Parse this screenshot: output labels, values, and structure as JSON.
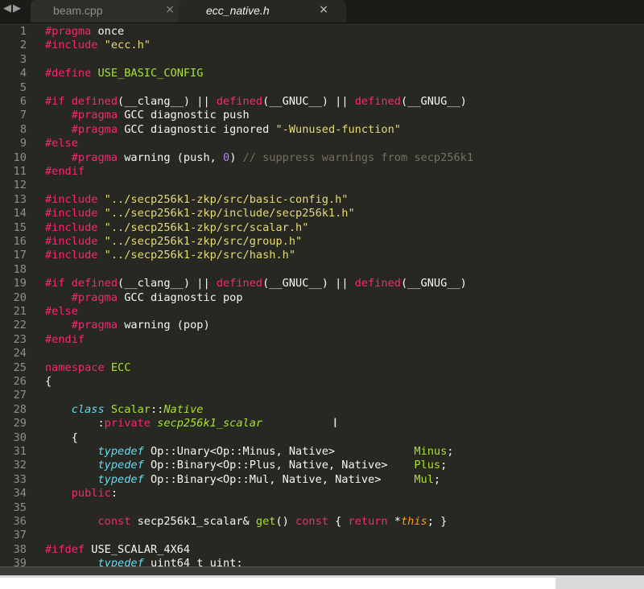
{
  "tabs": [
    {
      "label": "beam.cpp",
      "close": "×",
      "active": false
    },
    {
      "label": "ecc_native.h",
      "close": "×",
      "active": true
    }
  ],
  "nav": {
    "back": "◀",
    "forward": "▶"
  },
  "colors": {
    "background": "#272822",
    "keyword": "#f92672",
    "string": "#e6db74",
    "function": "#a6e22e",
    "storage": "#66d9ef",
    "comment": "#75715e",
    "number": "#ae81ff",
    "this": "#fd971f"
  },
  "lines": [
    {
      "n": "1",
      "t": [
        [
          "pp",
          "#pragma"
        ],
        [
          "plain",
          " once"
        ]
      ]
    },
    {
      "n": "2",
      "t": [
        [
          "pp",
          "#include"
        ],
        [
          "plain",
          " "
        ],
        [
          "str",
          "\"ecc.h\""
        ]
      ]
    },
    {
      "n": "3",
      "t": []
    },
    {
      "n": "4",
      "t": [
        [
          "pp",
          "#define"
        ],
        [
          "plain",
          " "
        ],
        [
          "macro",
          "USE_BASIC_CONFIG"
        ]
      ]
    },
    {
      "n": "5",
      "t": []
    },
    {
      "n": "6",
      "t": [
        [
          "pp",
          "#if"
        ],
        [
          "plain",
          " "
        ],
        [
          "kw",
          "defined"
        ],
        [
          "plain",
          "(__clang__) || "
        ],
        [
          "kw",
          "defined"
        ],
        [
          "plain",
          "(__GNUC__) || "
        ],
        [
          "kw",
          "defined"
        ],
        [
          "plain",
          "(__GNUG__)"
        ]
      ]
    },
    {
      "n": "7",
      "t": [
        [
          "plain",
          "    "
        ],
        [
          "pp",
          "#pragma"
        ],
        [
          "plain",
          " GCC diagnostic push"
        ]
      ]
    },
    {
      "n": "8",
      "t": [
        [
          "plain",
          "    "
        ],
        [
          "pp",
          "#pragma"
        ],
        [
          "plain",
          " GCC diagnostic ignored "
        ],
        [
          "str",
          "\"-Wunused-function\""
        ]
      ]
    },
    {
      "n": "9",
      "t": [
        [
          "pp",
          "#else"
        ]
      ]
    },
    {
      "n": "10",
      "t": [
        [
          "plain",
          "    "
        ],
        [
          "pp",
          "#pragma"
        ],
        [
          "plain",
          " warning (push, "
        ],
        [
          "num",
          "0"
        ],
        [
          "plain",
          ") "
        ],
        [
          "cmt",
          "// suppress warnings from secp256k1"
        ]
      ]
    },
    {
      "n": "11",
      "t": [
        [
          "pp",
          "#endif"
        ]
      ]
    },
    {
      "n": "12",
      "t": []
    },
    {
      "n": "13",
      "t": [
        [
          "pp",
          "#include"
        ],
        [
          "plain",
          " "
        ],
        [
          "str",
          "\"../secp256k1-zkp/src/basic-config.h\""
        ]
      ]
    },
    {
      "n": "14",
      "t": [
        [
          "pp",
          "#include"
        ],
        [
          "plain",
          " "
        ],
        [
          "str",
          "\"../secp256k1-zkp/include/secp256k1.h\""
        ]
      ]
    },
    {
      "n": "15",
      "t": [
        [
          "pp",
          "#include"
        ],
        [
          "plain",
          " "
        ],
        [
          "str",
          "\"../secp256k1-zkp/src/scalar.h\""
        ]
      ]
    },
    {
      "n": "16",
      "t": [
        [
          "pp",
          "#include"
        ],
        [
          "plain",
          " "
        ],
        [
          "str",
          "\"../secp256k1-zkp/src/group.h\""
        ]
      ]
    },
    {
      "n": "17",
      "t": [
        [
          "pp",
          "#include"
        ],
        [
          "plain",
          " "
        ],
        [
          "str",
          "\"../secp256k1-zkp/src/hash.h\""
        ]
      ]
    },
    {
      "n": "18",
      "t": []
    },
    {
      "n": "19",
      "t": [
        [
          "pp",
          "#if"
        ],
        [
          "plain",
          " "
        ],
        [
          "kw",
          "defined"
        ],
        [
          "plain",
          "(__clang__) || "
        ],
        [
          "kw",
          "defined"
        ],
        [
          "plain",
          "(__GNUC__) || "
        ],
        [
          "kw",
          "defined"
        ],
        [
          "plain",
          "(__GNUG__)"
        ]
      ]
    },
    {
      "n": "20",
      "t": [
        [
          "plain",
          "    "
        ],
        [
          "pp",
          "#pragma"
        ],
        [
          "plain",
          " GCC diagnostic pop"
        ]
      ]
    },
    {
      "n": "21",
      "t": [
        [
          "pp",
          "#else"
        ]
      ]
    },
    {
      "n": "22",
      "t": [
        [
          "plain",
          "    "
        ],
        [
          "pp",
          "#pragma"
        ],
        [
          "plain",
          " warning (pop)"
        ]
      ]
    },
    {
      "n": "23",
      "t": [
        [
          "pp",
          "#endif"
        ]
      ]
    },
    {
      "n": "24",
      "t": []
    },
    {
      "n": "25",
      "t": [
        [
          "kw",
          "namespace"
        ],
        [
          "plain",
          " "
        ],
        [
          "type",
          "ECC"
        ]
      ]
    },
    {
      "n": "26",
      "t": [
        [
          "plain",
          "{"
        ]
      ]
    },
    {
      "n": "27",
      "t": []
    },
    {
      "n": "28",
      "t": [
        [
          "plain",
          "    "
        ],
        [
          "storage",
          "class"
        ],
        [
          "plain",
          " "
        ],
        [
          "type",
          "Scalar"
        ],
        [
          "plain",
          "::"
        ],
        [
          "ital",
          "Native"
        ]
      ]
    },
    {
      "n": "29",
      "t": [
        [
          "plain",
          "        :"
        ],
        [
          "kw",
          "private"
        ],
        [
          "plain",
          " "
        ],
        [
          "ital",
          "secp256k1_scalar"
        ]
      ]
    },
    {
      "n": "30",
      "t": [
        [
          "plain",
          "    {"
        ]
      ]
    },
    {
      "n": "31",
      "t": [
        [
          "plain",
          "        "
        ],
        [
          "storage",
          "typedef"
        ],
        [
          "plain",
          " Op::Unary<Op::Minus, Native>            "
        ],
        [
          "fn",
          "Minus"
        ],
        [
          "plain",
          ";"
        ]
      ]
    },
    {
      "n": "32",
      "t": [
        [
          "plain",
          "        "
        ],
        [
          "storage",
          "typedef"
        ],
        [
          "plain",
          " Op::Binary<Op::Plus, Native, Native>    "
        ],
        [
          "fn",
          "Plus"
        ],
        [
          "plain",
          ";"
        ]
      ]
    },
    {
      "n": "33",
      "t": [
        [
          "plain",
          "        "
        ],
        [
          "storage",
          "typedef"
        ],
        [
          "plain",
          " Op::Binary<Op::Mul, Native, Native>     "
        ],
        [
          "fn",
          "Mul"
        ],
        [
          "plain",
          ";"
        ]
      ]
    },
    {
      "n": "34",
      "t": [
        [
          "plain",
          "    "
        ],
        [
          "kw",
          "public"
        ],
        [
          "plain",
          ":"
        ]
      ]
    },
    {
      "n": "35",
      "t": []
    },
    {
      "n": "36",
      "t": [
        [
          "plain",
          "        "
        ],
        [
          "kw",
          "const"
        ],
        [
          "plain",
          " secp256k1_scalar& "
        ],
        [
          "fn",
          "get"
        ],
        [
          "plain",
          "() "
        ],
        [
          "kw",
          "const"
        ],
        [
          "plain",
          " { "
        ],
        [
          "kw",
          "return"
        ],
        [
          "plain",
          " *"
        ],
        [
          "this",
          "this"
        ],
        [
          "plain",
          "; }"
        ]
      ]
    },
    {
      "n": "37",
      "t": []
    },
    {
      "n": "38",
      "t": [
        [
          "pp",
          "#ifdef"
        ],
        [
          "plain",
          " USE_SCALAR_4X64"
        ]
      ]
    },
    {
      "n": "39",
      "t": [
        [
          "plain",
          "        "
        ],
        [
          "storage",
          "typedef"
        ],
        [
          "plain",
          " uint64_t uint;"
        ]
      ]
    }
  ]
}
